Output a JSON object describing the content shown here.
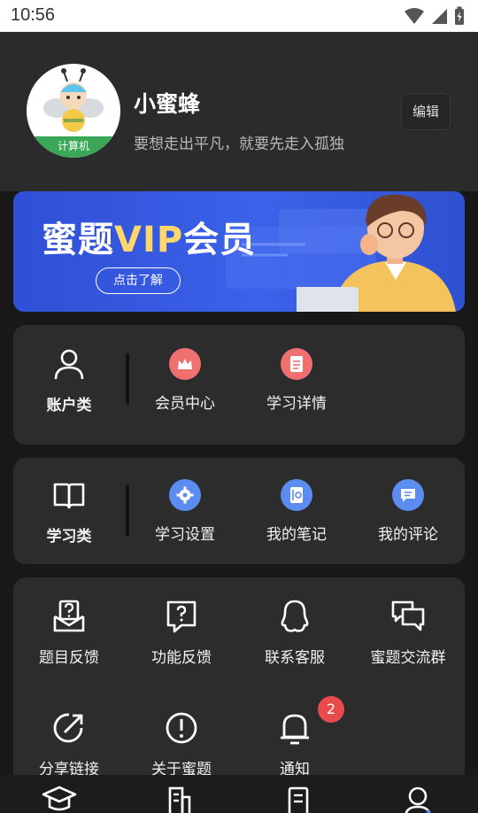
{
  "status_bar": {
    "time": "10:56"
  },
  "profile": {
    "name": "小蜜蜂",
    "motto": "要想走出平凡，就要先走入孤独",
    "avatar_tag": "计算机",
    "edit_label": "编辑"
  },
  "banner": {
    "title_prefix": "蜜题",
    "title_vip": "VIP",
    "title_suffix": "会员",
    "button_label": "点击了解"
  },
  "account_section": {
    "category": "账户类",
    "items": [
      {
        "label": "会员中心",
        "icon": "crown-icon",
        "color": "#f07070"
      },
      {
        "label": "学习详情",
        "icon": "document-icon",
        "color": "#f07070"
      }
    ]
  },
  "study_section": {
    "category": "学习类",
    "items": [
      {
        "label": "学习设置",
        "icon": "gear-icon",
        "color": "#5b8cf0"
      },
      {
        "label": "我的笔记",
        "icon": "notebook-icon",
        "color": "#5b8cf0"
      },
      {
        "label": "我的评论",
        "icon": "comment-icon",
        "color": "#5b8cf0"
      }
    ]
  },
  "more_section": {
    "items": [
      {
        "label": "题目反馈",
        "icon": "mail-question-icon"
      },
      {
        "label": "功能反馈",
        "icon": "chat-question-icon"
      },
      {
        "label": "联系客服",
        "icon": "qq-icon"
      },
      {
        "label": "蜜题交流群",
        "icon": "chat-group-icon"
      },
      {
        "label": "分享链接",
        "icon": "share-icon"
      },
      {
        "label": "关于蜜题",
        "icon": "info-icon"
      },
      {
        "label": "通知",
        "icon": "bell-icon",
        "badge": "2"
      }
    ]
  },
  "bottom_nav": {
    "items": [
      {
        "icon": "graduation-cap-icon"
      },
      {
        "icon": "building-icon"
      },
      {
        "icon": "notes-icon"
      },
      {
        "icon": "user-icon",
        "active": true
      }
    ]
  }
}
